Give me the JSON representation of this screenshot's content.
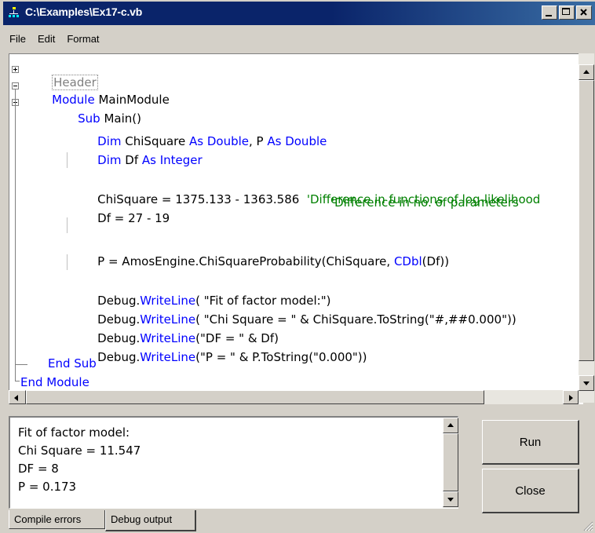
{
  "window": {
    "title": "C:\\Examples\\Ex17-c.vb"
  },
  "menu": {
    "items": [
      "File",
      "Edit",
      "Format"
    ]
  },
  "code": {
    "header": "Header",
    "module_kw": "Module",
    "module_name": " MainModule",
    "sub_kw": "Sub",
    "sub_name": " Main()",
    "dim1": {
      "kw1": "Dim",
      "t1": " ChiSquare ",
      "kw2": "As Double",
      "t2": ", P ",
      "kw3": "As Double"
    },
    "dim2": {
      "kw1": "Dim",
      "t1": " Df ",
      "kw2": "As Integer"
    },
    "chisq_line": {
      "code": "ChiSquare = 1375.133 - 1363.586  ",
      "comment": "'Difference in functions of log-likelihood"
    },
    "df_line": {
      "code": "Df = 27 - 19",
      "comment": "'Difference in no. of parameters"
    },
    "p_line": {
      "t1": "P = AmosEngine.ChiSquareProbability(ChiSquare, ",
      "kw": "CDbl",
      "t2": "(Df))"
    },
    "wl1": {
      "t1": "Debug.",
      "kw": "WriteLine",
      "t2": "( \"Fit of factor model:\")"
    },
    "wl2": {
      "t1": "Debug.",
      "kw": "WriteLine",
      "t2": "( \"Chi Square = \" & ChiSquare.ToString(\"#,##0.000\"))"
    },
    "wl3": {
      "t1": "Debug.",
      "kw": "WriteLine",
      "t2": "(\"DF = \" & Df)"
    },
    "wl4": {
      "t1": "Debug.",
      "kw": "WriteLine",
      "t2": "(\"P = \" & P.ToString(\"0.000\"))"
    },
    "end_sub": "End Sub",
    "end_module": "End Module"
  },
  "output": {
    "lines": [
      "Fit of factor model:",
      "Chi Square = 11.547",
      "DF = 8",
      "P = 0.173"
    ]
  },
  "buttons": {
    "run": "Run",
    "close": "Close"
  },
  "tabs": {
    "compile_errors": "Compile errors",
    "debug_output": "Debug output"
  },
  "colors": {
    "keyword": "#0000ff",
    "comment": "#008000",
    "titlebar": "#0a246a"
  }
}
